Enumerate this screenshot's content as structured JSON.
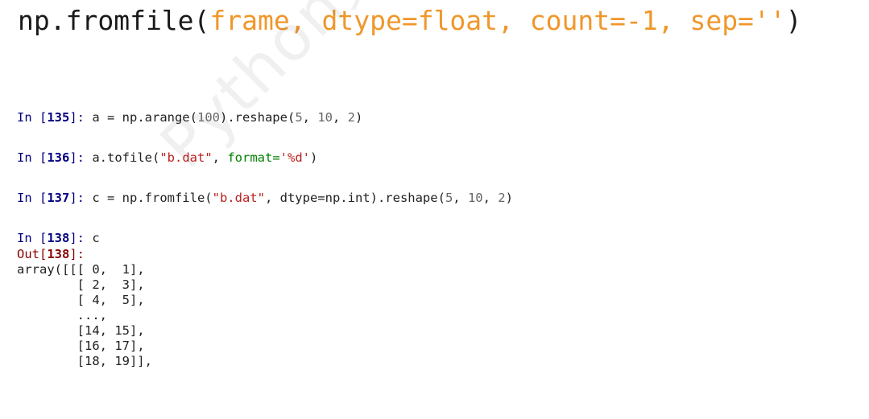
{
  "title": {
    "func": "np.fromfile(",
    "args": "frame, dtype=float, count=-1, sep=''",
    "close": ")"
  },
  "watermark": "Python数据分析与展示",
  "cells": [
    {
      "in_label": "In [",
      "num": "135",
      "suffix": "]: ",
      "code": [
        "a = np.arange(",
        "100",
        ").reshape(",
        "5",
        ", ",
        "10",
        ", ",
        "2",
        ")"
      ]
    },
    {
      "in_label": "In [",
      "num": "136",
      "suffix": "]: ",
      "code": [
        "a.tofile(",
        "\"b.dat\"",
        ", ",
        "format=",
        "'%d'",
        ")"
      ]
    },
    {
      "in_label": "In [",
      "num": "137",
      "suffix": "]: ",
      "code": [
        "c = np.fromfile(",
        "\"b.dat\"",
        ", dtype=np.int).reshape(",
        "5",
        ", ",
        "10",
        ", ",
        "2",
        ")"
      ]
    },
    {
      "in_label": "In [",
      "num": "138",
      "suffix": "]: ",
      "code": [
        "c"
      ]
    }
  ],
  "output": {
    "label": "Out[",
    "num": "138",
    "suffix": "]:",
    "lines": [
      "array([[[ 0,  1],",
      "        [ 2,  3],",
      "        [ 4,  5],",
      "        ...,",
      "        [14, 15],",
      "        [16, 17],",
      "        [18, 19]],"
    ]
  }
}
